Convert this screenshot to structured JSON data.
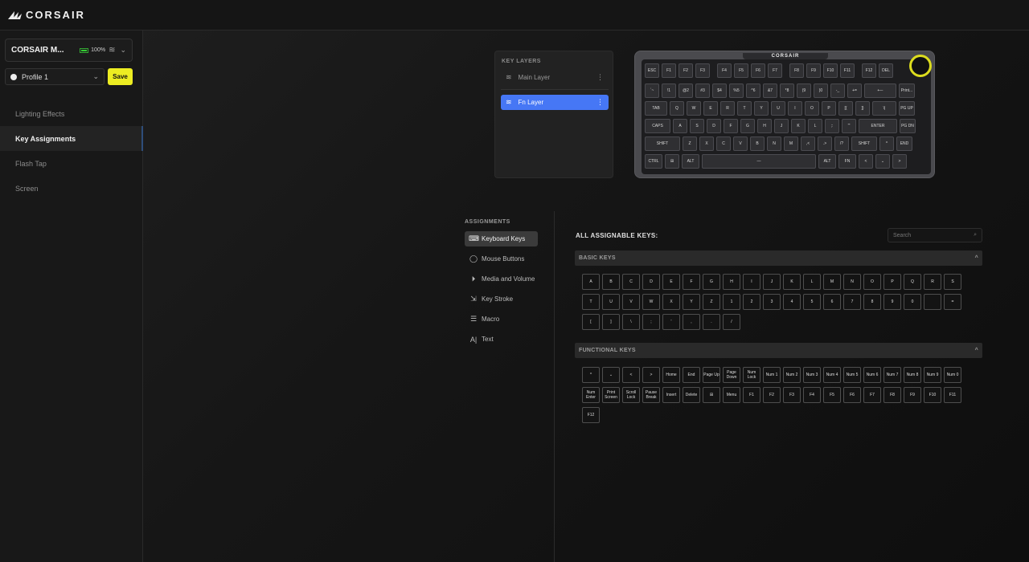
{
  "app": {
    "brand": "CORSAIR"
  },
  "device": {
    "name": "CORSAIR M...",
    "battery": "100%"
  },
  "profile": {
    "name": "Profile 1",
    "save_label": "Save"
  },
  "nav": [
    {
      "label": "Lighting Effects",
      "active": false
    },
    {
      "label": "Key Assignments",
      "active": true
    },
    {
      "label": "Flash Tap",
      "active": false
    },
    {
      "label": "Screen",
      "active": false
    }
  ],
  "layers": {
    "title": "KEY LAYERS",
    "items": [
      {
        "label": "Main Layer",
        "active": false
      },
      {
        "label": "Fn Layer",
        "active": true
      }
    ]
  },
  "keyboard": {
    "brand": "CORSAIR",
    "rows": [
      [
        "ESC",
        "F1",
        "F2",
        "F3",
        "F4",
        "F5",
        "F6",
        "F7",
        "F8",
        "F9",
        "F10",
        "F11",
        "F12",
        "DEL"
      ],
      [
        "`~",
        "!1",
        "@2",
        "#3",
        "$4",
        "%5",
        "^6",
        "&7",
        "*8",
        "(9",
        ")0",
        "-_",
        "+=",
        "⟵",
        "Print..."
      ],
      [
        "TAB",
        "Q",
        "W",
        "E",
        "R",
        "T",
        "Y",
        "U",
        "I",
        "O",
        "P",
        "[{",
        "]}",
        "\\|",
        "PG UP"
      ],
      [
        "CAPS",
        "A",
        "S",
        "D",
        "F",
        "G",
        "H",
        "J",
        "K",
        "L",
        ";:",
        "'\"",
        "ENTER",
        "PG DN"
      ],
      [
        "SHIFT",
        "Z",
        "X",
        "C",
        "V",
        "B",
        "N",
        "M",
        ",<",
        ".>",
        "/?",
        "SHIFT",
        "^",
        "END"
      ],
      [
        "CTRL",
        "⊞",
        "ALT",
        "—",
        "ALT",
        "FN",
        "<",
        "⌄",
        ">"
      ]
    ]
  },
  "assignments": {
    "title": "ASSIGNMENTS",
    "items": [
      {
        "label": "Keyboard Keys",
        "icon": "keyboard-icon",
        "glyph": "⌨",
        "active": true
      },
      {
        "label": "Mouse Buttons",
        "icon": "mouse-icon",
        "glyph": "◯",
        "active": false
      },
      {
        "label": "Media and Volume",
        "icon": "media-icon",
        "glyph": "⏵",
        "active": false
      },
      {
        "label": "Key Stroke",
        "icon": "keystroke-icon",
        "glyph": "⇲",
        "active": false
      },
      {
        "label": "Macro",
        "icon": "macro-icon",
        "glyph": "☰",
        "active": false
      },
      {
        "label": "Text",
        "icon": "text-icon",
        "glyph": "A|",
        "active": false
      }
    ]
  },
  "all_keys": {
    "title": "ALL ASSIGNABLE KEYS:",
    "search_placeholder": "Search",
    "basic": {
      "label": "BASIC KEYS",
      "keys": [
        "A",
        "B",
        "C",
        "D",
        "E",
        "F",
        "G",
        "H",
        "I",
        "J",
        "K",
        "L",
        "M",
        "N",
        "O",
        "P",
        "Q",
        "R",
        "S",
        "T",
        "U",
        "V",
        "W",
        "X",
        "Y",
        "Z",
        "1",
        "2",
        "3",
        "4",
        "5",
        "6",
        "7",
        "8",
        "9",
        "0",
        "",
        "=",
        "[",
        "]",
        "\\",
        ";",
        "'",
        ",",
        ".",
        "/"
      ]
    },
    "functional": {
      "label": "FUNCTIONAL KEYS",
      "keys": [
        "^",
        "⌄",
        "<",
        ">",
        "Home",
        "End",
        "Page Up",
        "Page Down",
        "Num Lock",
        "Num 1",
        "Num 2",
        "Num 3",
        "Num 4",
        "Num 5",
        "Num 6",
        "Num 7",
        "Num 8",
        "Num 9",
        "Num 0",
        "Num Enter",
        "Print Screen",
        "Scroll Lock",
        "Pause Break",
        "Insert",
        "Delete",
        "⊞",
        "Menu",
        "F1",
        "F2",
        "F3",
        "F4",
        "F5",
        "F6",
        "F7",
        "F8",
        "F9",
        "F10",
        "F11",
        "F12"
      ]
    }
  }
}
